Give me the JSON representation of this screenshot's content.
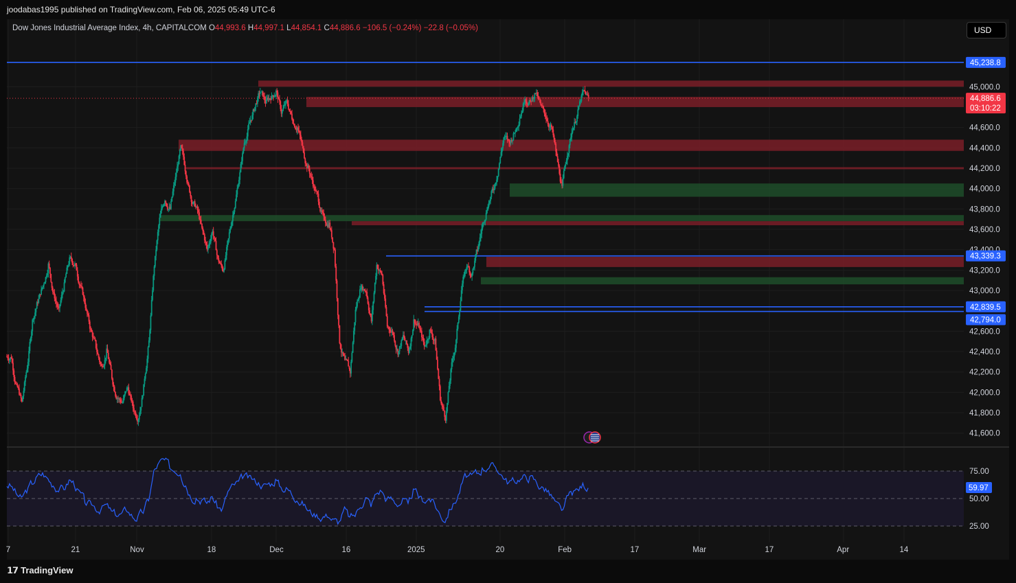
{
  "header": {
    "published": "joodabas1995 published on TradingView.com, Feb 06, 2025 05:49 UTC-6"
  },
  "legend": {
    "symbol": "Dow Jones Industrial Average Index, 4h, CAPITALCOM",
    "open_k": "O",
    "open_v": "44,993.6",
    "high_k": "H",
    "high_v": "44,997.1",
    "low_k": "L",
    "low_v": "44,854.1",
    "close_k": "C",
    "close_v": "44,886.6",
    "change": "−106.5 (−0.24%)",
    "change2": "−22.8 (−0.05%)"
  },
  "currency_button": "USD",
  "footer": {
    "brand": "TradingView"
  },
  "colors": {
    "up": "#089981",
    "down": "#f23645",
    "blue_line": "#2962ff",
    "red_zone": "#7a1e28",
    "green_zone": "#1f4d2a",
    "rsi": "#2962ff"
  },
  "chart_data": [
    {
      "type": "candlestick",
      "title": "",
      "y_axis_ticks": [
        "45,000.0",
        "44,600.0",
        "44,400.0",
        "44,200.0",
        "44,000.0",
        "43,800.0",
        "43,600.0",
        "43,400.0",
        "43,200.0",
        "43,000.0",
        "42,600.0",
        "42,400.0",
        "42,200.0",
        "42,000.0",
        "41,800.0",
        "41,600.0"
      ],
      "y_axis_tick_values": [
        45000,
        44600,
        44400,
        44200,
        44000,
        43800,
        43600,
        43400,
        43200,
        43000,
        42600,
        42400,
        42200,
        42000,
        41800,
        41600
      ],
      "ylim": [
        41470,
        45460
      ],
      "x_axis_ticks": [
        "7",
        "21",
        "Nov",
        "18",
        "Dec",
        "16",
        "2025",
        "20",
        "Feb",
        "17",
        "Mar",
        "17",
        "Apr",
        "14"
      ],
      "price_levels": [
        {
          "label": "45,238.8",
          "value": 45238.8,
          "kind": "horizontal-line"
        },
        {
          "label": "43,339.3",
          "value": 43339.3,
          "kind": "horizontal-line"
        },
        {
          "label": "42,839.5",
          "value": 42839.5,
          "kind": "horizontal-line"
        },
        {
          "label": "42,794.0",
          "value": 42794.0,
          "kind": "horizontal-line"
        }
      ],
      "last_price": {
        "label": "44,886.6",
        "value": 44886.6,
        "countdown": "03:10:22"
      },
      "zones": [
        {
          "kind": "resistance",
          "from": 45000,
          "to": 45060
        },
        {
          "kind": "resistance",
          "from": 44800,
          "to": 44900
        },
        {
          "kind": "resistance",
          "from": 44370,
          "to": 44480
        },
        {
          "kind": "resistance",
          "from": 44190,
          "to": 44210
        },
        {
          "kind": "support",
          "from": 43920,
          "to": 44050
        },
        {
          "kind": "support",
          "from": 43680,
          "to": 43740
        },
        {
          "kind": "resistance",
          "from": 43640,
          "to": 43680
        },
        {
          "kind": "resistance",
          "from": 43230,
          "to": 43330
        },
        {
          "kind": "support",
          "from": 43060,
          "to": 43130
        }
      ],
      "price_path": [
        42350,
        42050,
        41900,
        42250,
        42700,
        42900,
        43050,
        43250,
        42950,
        42800,
        43050,
        43300,
        43250,
        43050,
        42850,
        42600,
        42450,
        42250,
        42400,
        42150,
        41950,
        41900,
        42050,
        41850,
        41750,
        42050,
        42500,
        43250,
        43700,
        43900,
        43800,
        44100,
        44400,
        44150,
        43900,
        43800,
        43600,
        43400,
        43600,
        43300,
        43200,
        43500,
        43800,
        44100,
        44450,
        44650,
        44800,
        44950,
        44850,
        44900,
        44950,
        44750,
        44850,
        44700,
        44600,
        44400,
        44200,
        44050,
        43900,
        43700,
        43650,
        43400,
        42500,
        42300,
        42200,
        42800,
        43050,
        43000,
        42700,
        43250,
        43150,
        42650,
        42600,
        42400,
        42550,
        42400,
        42700,
        42650,
        42450,
        42600,
        42500,
        41950,
        41750,
        42200,
        42500,
        43000,
        43250,
        43150,
        43400,
        43650,
        43850,
        44000,
        44200,
        44500,
        44450,
        44550,
        44700,
        44900,
        44850,
        44950,
        44800,
        44700,
        44600,
        44300,
        44000,
        44350,
        44600,
        44750,
        44950,
        44890
      ],
      "rsi": {
        "label": "59.97",
        "value": 59.97,
        "levels": [
          75.0,
          50.0,
          25.0
        ],
        "level_labels": [
          "75.00",
          "50.00",
          "25.00"
        ],
        "ylim": [
          10,
          90
        ],
        "series": [
          62,
          55,
          50,
          58,
          65,
          70,
          72,
          68,
          62,
          58,
          60,
          66,
          64,
          55,
          48,
          45,
          42,
          40,
          44,
          38,
          35,
          36,
          40,
          34,
          32,
          38,
          50,
          74,
          82,
          85,
          80,
          76,
          74,
          62,
          52,
          50,
          48,
          46,
          52,
          44,
          40,
          56,
          62,
          65,
          70,
          68,
          66,
          64,
          62,
          64,
          66,
          60,
          58,
          55,
          50,
          45,
          40,
          36,
          35,
          33,
          35,
          30,
          28,
          40,
          32,
          35,
          44,
          50,
          45,
          55,
          58,
          48,
          50,
          45,
          48,
          44,
          56,
          52,
          48,
          50,
          46,
          36,
          30,
          42,
          48,
          60,
          72,
          70,
          74,
          76,
          78,
          80,
          76,
          70,
          64,
          66,
          68,
          70,
          68,
          66,
          60,
          58,
          52,
          45,
          38,
          50,
          56,
          58,
          62,
          59.97
        ]
      }
    }
  ]
}
